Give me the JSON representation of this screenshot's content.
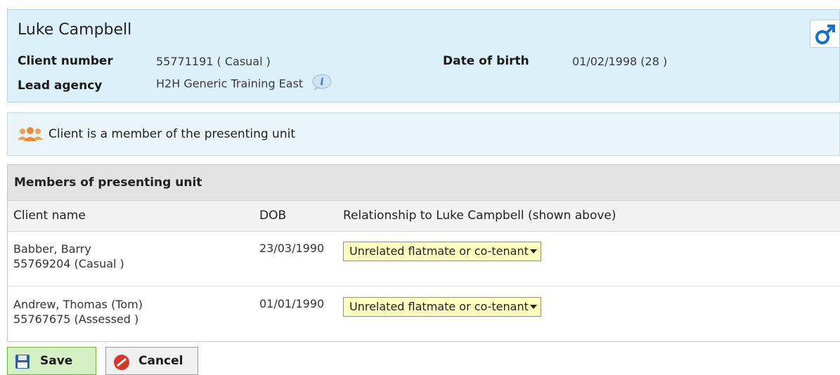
{
  "client": {
    "name": "Luke Campbell",
    "client_number_label": "Client number",
    "client_number_value": "55771191 ( Casual )",
    "date_of_birth_label": "Date of birth",
    "date_of_birth_value": "01/02/1998 (28 )",
    "lead_agency_label": "Lead agency",
    "lead_agency_value": "H2H Generic Training East",
    "gender_icon": "male-symbol-icon",
    "info_icon": "info-icon"
  },
  "banner": {
    "icon": "people-group-icon",
    "text": "Client is a member of the presenting unit"
  },
  "members": {
    "title": "Members of presenting unit",
    "columns": [
      "Client name",
      "DOB",
      "Relationship to Luke Campbell (shown above)"
    ],
    "rows": [
      {
        "name": "Babber, Barry",
        "client_number": "55769204 (Casual )",
        "dob": "23/03/1990",
        "relationship": "Unrelated flatmate or co-tenant"
      },
      {
        "name": "Andrew, Thomas (Tom)",
        "client_number": "55767675 (Assessed )",
        "dob": "01/01/1990",
        "relationship": "Unrelated flatmate or co-tenant"
      }
    ]
  },
  "actions": {
    "save_label": "Save",
    "cancel_label": "Cancel"
  },
  "colors": {
    "header_bg": "#dcf0fa",
    "select_bg": "#ffffc0",
    "save_bg": "#d6f0c6",
    "gender_blue": "#1a6fc2",
    "agency_orange": "#f0a050"
  }
}
